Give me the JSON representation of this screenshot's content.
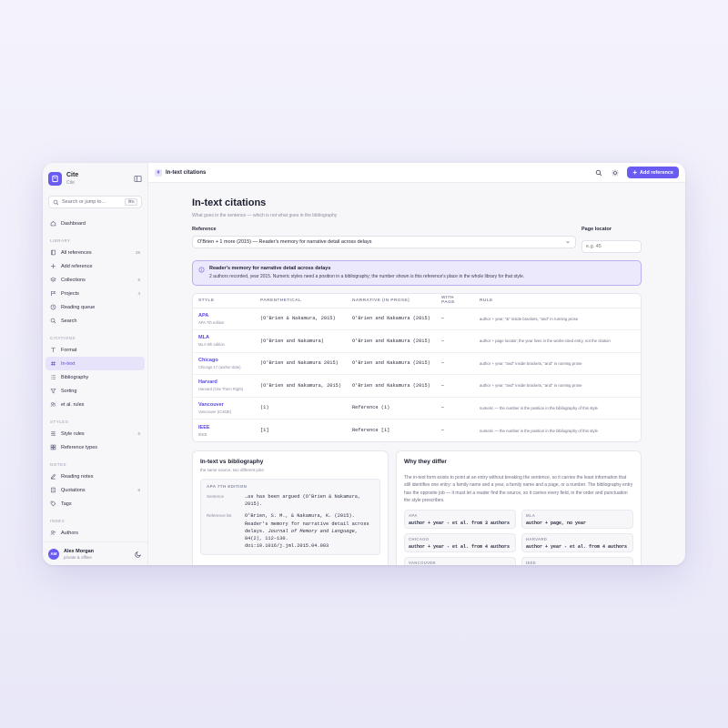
{
  "brand": {
    "name": "Cite",
    "sub": "Cite"
  },
  "search": {
    "placeholder": "Search or jump to...",
    "shortcut": "⌘K"
  },
  "sidebar": {
    "top": {
      "label": "Dashboard"
    },
    "library_label": "LIBRARY",
    "library": [
      {
        "label": "All references",
        "count": "26"
      },
      {
        "label": "Add reference",
        "count": ""
      },
      {
        "label": "Collections",
        "count": "5"
      },
      {
        "label": "Projects",
        "count": "4"
      },
      {
        "label": "Reading queue",
        "count": ""
      },
      {
        "label": "Search",
        "count": ""
      }
    ],
    "citations_label": "CITATIONS",
    "citations": [
      {
        "label": "Format"
      },
      {
        "label": "In-text"
      },
      {
        "label": "Bibliography"
      },
      {
        "label": "Sorting"
      },
      {
        "label": "et al. rules"
      }
    ],
    "styles_label": "STYLES",
    "styles": [
      {
        "label": "Style rules",
        "count": "6"
      },
      {
        "label": "Reference types",
        "count": ""
      }
    ],
    "notes_label": "NOTES",
    "notes": [
      {
        "label": "Reading notes",
        "count": ""
      },
      {
        "label": "Quotations",
        "count": "8"
      },
      {
        "label": "Tags",
        "count": ""
      }
    ],
    "index_label": "INDEX",
    "index": [
      {
        "label": "Authors"
      }
    ]
  },
  "user": {
    "initials": "AM",
    "name": "Alex Morgan",
    "status": "private & offline"
  },
  "topbar": {
    "emblem": "#",
    "title": "In-text citations",
    "add_label": "Add reference"
  },
  "page": {
    "title": "In-text citations",
    "subtitle": "What goes in the sentence — which is not what goes in the bibliography",
    "reference_label": "Reference",
    "reference_value": "O'Brien + 1 more (2015) — Reader's memory for narrative detail across delays",
    "page_locator_label": "Page locator",
    "page_locator_placeholder": "e.g. 45"
  },
  "banner": {
    "title": "Reader's memory for narrative detail across delays",
    "body": "2 authors recorded, year 2015. Numeric styles need a position in a bibliography; the number shown is this reference's place in the whole library for that style."
  },
  "table": {
    "headers": [
      "STYLE",
      "PARENTHETICAL",
      "NARRATIVE (IN PROSE)",
      "WITH PAGE",
      "RULE"
    ],
    "rows": [
      {
        "style": "APA",
        "sub": "APA 7th edition",
        "paren": "(O'Brien & Nakamura, 2015)",
        "narr": "O'Brien and Nakamura (2015)",
        "page": "–",
        "rule": "author + year; \"&\" inside brackets, \"and\" in running prose"
      },
      {
        "style": "MLA",
        "sub": "MLA 9th edition",
        "paren": "(O'Brien and Nakamura)",
        "narr": "O'Brien and Nakamura (2015)",
        "page": "–",
        "rule": "author + page locator; the year lives in the works-cited entry, not the citation"
      },
      {
        "style": "Chicago",
        "sub": "Chicago 17 (author-date)",
        "paren": "(O'Brien and Nakamura 2015)",
        "narr": "O'Brien and Nakamura (2015)",
        "page": "–",
        "rule": "author + year; \"and\" inside brackets, \"and\" in running prose"
      },
      {
        "style": "Harvard",
        "sub": "Harvard (Cite Them Right)",
        "paren": "(O'Brien and Nakamura, 2015)",
        "narr": "O'Brien and Nakamura (2015)",
        "page": "–",
        "rule": "author + year; \"and\" inside brackets, \"and\" in running prose"
      },
      {
        "style": "Vancouver",
        "sub": "Vancouver (ICMJE)",
        "paren": "(1)",
        "narr": "Reference (1)",
        "page": "–",
        "rule": "numeric — the number is the position in the bibliography of this style"
      },
      {
        "style": "IEEE",
        "sub": "IEEE",
        "paren": "[1]",
        "narr": "Reference [1]",
        "page": "–",
        "rule": "numeric — the number is the position in the bibliography of this style"
      }
    ]
  },
  "vs_card": {
    "title": "In-text vs bibliography",
    "sub": "the same source, two different jobs",
    "box_head": "APA 7TH EDITION",
    "sentence_label": "Sentence",
    "sentence_value": "…as has been argued (O'Brien & Nakamura, 2015).",
    "ref_label": "Reference list",
    "ref_pre": "O'Brien, S. M., & Nakamura, K. (2015). Reader's memory for narrative detail across delays. ",
    "ref_journal": "Journal of Memory and Language",
    "ref_post": ", 84(2), 112–130. doi:10.1016/j.jml.2015.04.003"
  },
  "why_card": {
    "title": "Why they differ",
    "body": "The in-text form exists to point at an entry without breaking the sentence, so it carries the least information that still identifies one entry: a family name and a year, a family name and a page, or a number. The bibliography entry has the opposite job — it must let a reader find the source, so it carries every field, in the order and punctuation the style prescribes.",
    "items": [
      {
        "label": "APA",
        "value": "author + year - et al. from 3 authors"
      },
      {
        "label": "MLA",
        "value": "author + page, no year"
      },
      {
        "label": "CHICAGO",
        "value": "author + year - et al. from 4 authors"
      },
      {
        "label": "HARVARD",
        "value": "author + year - et al. from 4 authors"
      },
      {
        "label": "VANCOUVER",
        "value": ""
      },
      {
        "label": "IEEE",
        "value": ""
      }
    ]
  }
}
